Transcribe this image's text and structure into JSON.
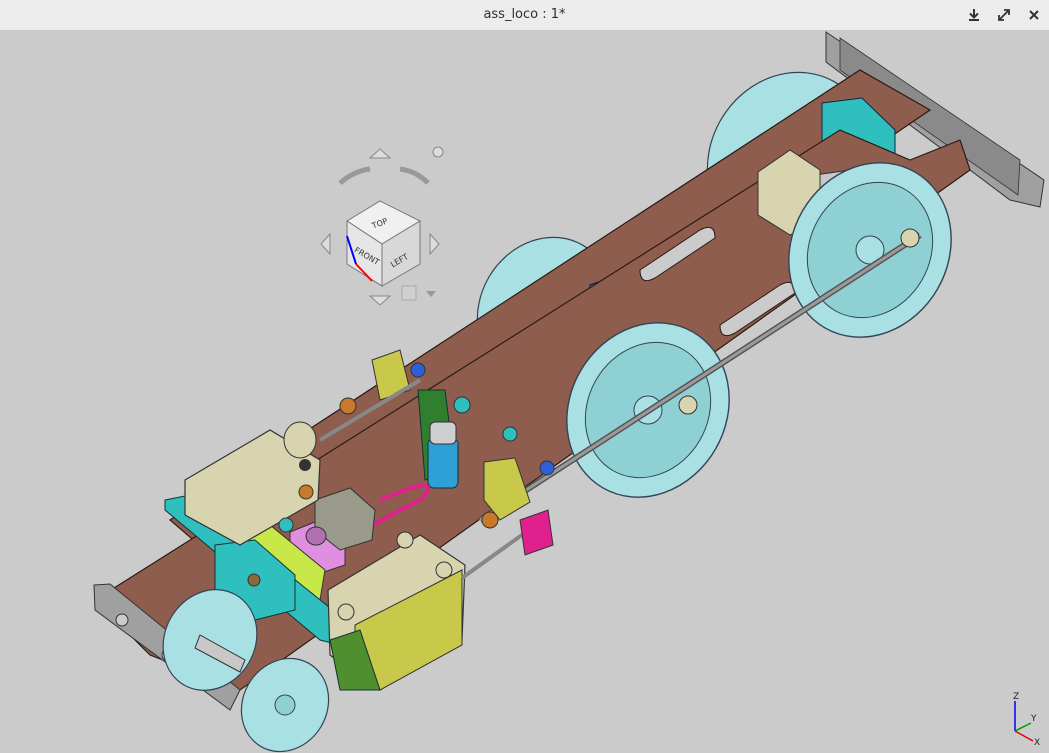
{
  "window": {
    "title": "ass_loco : 1*"
  },
  "titlebar_buttons": {
    "download": "download-icon",
    "maximize": "maximize-icon",
    "close": "close-icon"
  },
  "navcube": {
    "faces": {
      "top": "TOP",
      "front": "FRONT",
      "left": "LEFT"
    }
  },
  "axis_triad": {
    "z": "Z",
    "y": "Y",
    "x": "X",
    "colors": {
      "z": "#0000ff",
      "y": "#00a000",
      "x": "#e00000"
    }
  },
  "colors": {
    "background": "#cbcbcb",
    "frame": "#8f5d4d",
    "wheel": "#a8e0e3",
    "cylinder": "#d8d4b0",
    "teal": "#2fbfbf",
    "blue": "#2f7fc7",
    "yellow_green": "#c8e84a",
    "pink": "#e08ee0",
    "magenta": "#e0208c",
    "olive": "#c8c84a"
  }
}
